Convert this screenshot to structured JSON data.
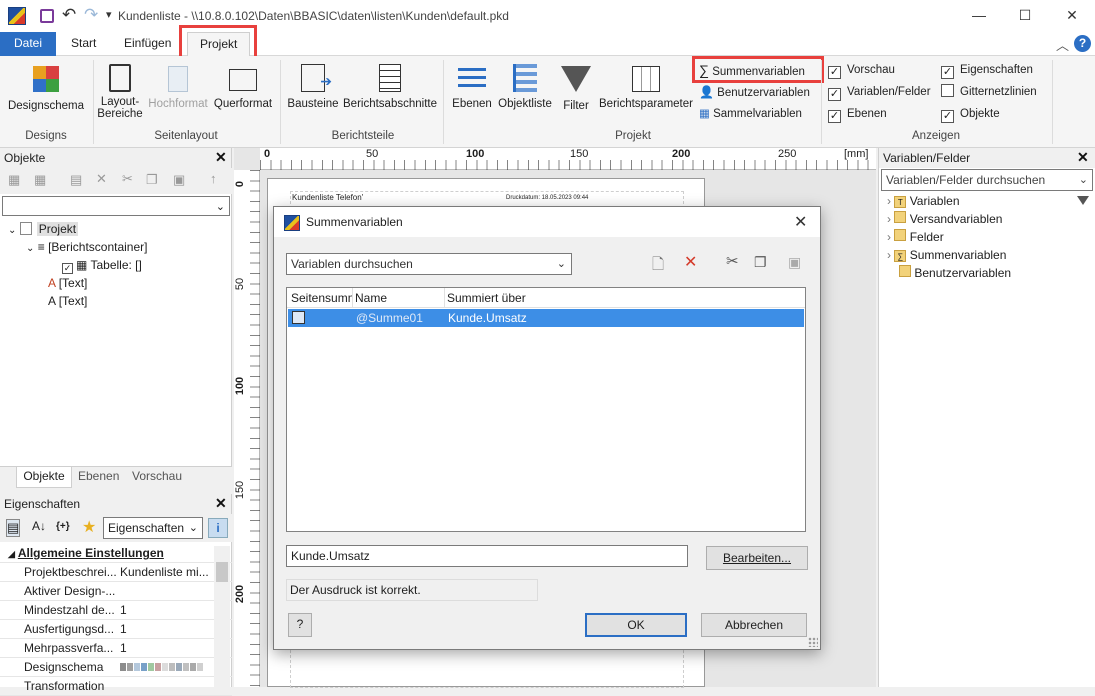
{
  "app": {
    "title": "Kundenliste - \\\\10.8.0.102\\Daten\\BBASIC\\daten\\listen\\Kunden\\default.pkd",
    "qat_dropdown": "▾"
  },
  "tabs": [
    "Datei",
    "Start",
    "Einfügen",
    "Projekt"
  ],
  "ribbon": {
    "designs": {
      "designschema": "Designschema",
      "group": "Designs"
    },
    "seitenlayout": {
      "layout1": "Layout-",
      "layout2": "Bereiche",
      "hochformat": "Hochformat",
      "querformat": "Querformat",
      "group": "Seitenlayout"
    },
    "berichtsteile": {
      "bausteine": "Bausteine",
      "berichtsabschnitte": "Berichtsabschnitte",
      "group": "Berichtsteile"
    },
    "projekt": {
      "ebenen": "Ebenen",
      "objektliste": "Objektliste",
      "filter": "Filter",
      "berichtsparameter": "Berichtsparameter",
      "summenvariablen": "Summenvariablen",
      "benutzervariablen": "Benutzervariablen",
      "sammelvariablen": "Sammelvariablen",
      "group": "Projekt"
    },
    "anzeigen": {
      "vorschau": "Vorschau",
      "variablen_felder": "Variablen/Felder",
      "ebenen": "Ebenen",
      "eigenschaften": "Eigenschaften",
      "gitternetzlinien": "Gitternetzlinien",
      "objekte": "Objekte",
      "group": "Anzeigen"
    }
  },
  "objekte_panel": {
    "title": "Objekte",
    "tree": {
      "projekt": "Projekt",
      "berichtscontainer": "[Berichtscontainer]",
      "tabelle": "Tabelle: []",
      "text1": "[Text]",
      "text2": "[Text]"
    },
    "bottom_tabs": [
      "Objekte",
      "Ebenen",
      "Vorschau"
    ]
  },
  "eigenschaften_panel": {
    "title": "Eigenschaften",
    "dropdown": "Eigenschaften",
    "toolbar_brace": "{+}",
    "section": "Allgemeine Einstellungen",
    "rows": [
      {
        "name": "Projektbeschrei...",
        "value": "Kundenliste mi..."
      },
      {
        "name": "Aktiver Design-...",
        "value": ""
      },
      {
        "name": "Mindestzahl de...",
        "value": "1"
      },
      {
        "name": "Ausfertigungsd...",
        "value": "1"
      },
      {
        "name": "Mehrpassverfa...",
        "value": "1"
      },
      {
        "name": "Designschema",
        "value": ""
      },
      {
        "name": "Transformation",
        "value": ""
      }
    ],
    "swatches": [
      "#8c8c8c",
      "#a0a0a0",
      "#b4c8dc",
      "#78a0c8",
      "#a0c8a0",
      "#c8a0a0",
      "#dcdcdc",
      "#bdbdbd",
      "#9aa9b9",
      "#c0c0c0",
      "#aaaaaa",
      "#d0d0d0"
    ]
  },
  "ruler": {
    "unit": "[mm]",
    "h_ticks": [
      "0",
      "50",
      "100",
      "150",
      "200",
      "250"
    ],
    "v_ticks": [
      "0",
      "50",
      "100",
      "150",
      "200"
    ]
  },
  "page_preview": {
    "header_left": "Kundenliste Telefon'",
    "header_right": "Druckdatum: 18.05.2023 09:44"
  },
  "variablen_panel": {
    "title": "Variablen/Felder",
    "search_placeholder": "Variablen/Felder durchsuchen",
    "items": [
      "Variablen",
      "Versandvariablen",
      "Felder",
      "Summenvariablen",
      "Benutzervariablen"
    ]
  },
  "dialog": {
    "title": "Summenvariablen",
    "search_placeholder": "Variablen durchsuchen",
    "columns": [
      "Seitensumme",
      "Name",
      "Summiert über"
    ],
    "rows": [
      {
        "name": "@Summe01",
        "summiert": "Kunde.Umsatz"
      }
    ],
    "expression": "Kunde.Umsatz",
    "edit_button": "Bearbeiten...",
    "status": "Der Ausdruck ist korrekt.",
    "ok": "OK",
    "cancel": "Abbrechen"
  },
  "colors": {
    "accent": "#2b6ec4",
    "highlight": "#e8403d",
    "selection": "#3d8ee6"
  }
}
